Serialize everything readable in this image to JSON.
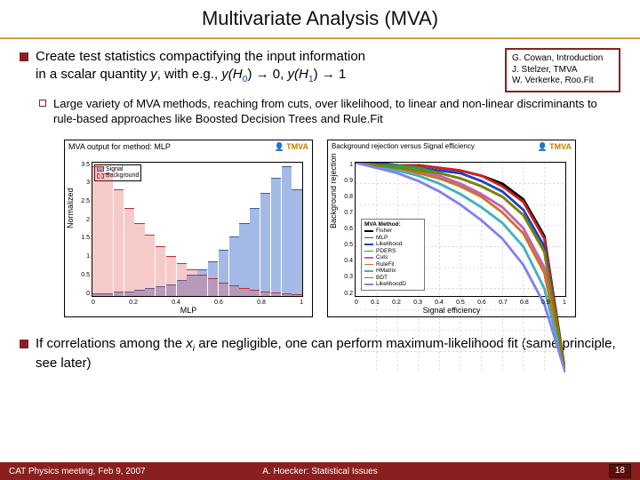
{
  "title": "Multivariate Analysis (MVA)",
  "bullet1": {
    "line1": "Create test statistics compactifying the input information",
    "line2_pre": "in a scalar quantity ",
    "y": "y",
    "mid1": ", with e.g., ",
    "yh0": "y(H",
    "h0sub": "0",
    "arrow1": ") → 0, ",
    "yh1": "y(H",
    "h1sub": "1",
    "arrow2": ") → 1"
  },
  "refs": {
    "l1": "G. Cowan, Introduction",
    "l2": "J. Stelzer, TMVA",
    "l3": "W. Verkerke, Roo.Fit"
  },
  "bullet2": "Large variety of MVA methods, reaching from cuts, over likelihood, to linear and non-linear discriminants to rule-based approaches like Boosted Decision Trees and Rule.Fit",
  "chart1": {
    "title": "MVA output for method: MLP",
    "logo": "TMVA",
    "ylabel": "Normalized",
    "xlabel": "MLP",
    "legend_sig": "Signal",
    "legend_bkg": "Background",
    "xticks": [
      "0",
      "0.2",
      "0.4",
      "0.6",
      "0.8",
      "1"
    ],
    "yticks": [
      "0",
      "0.5",
      "1",
      "1.5",
      "2",
      "2.5",
      "3",
      "3.5"
    ]
  },
  "chart2": {
    "title": "Background rejection versus Signal efficiency",
    "logo": "TMVA",
    "ylabel": "Background rejection",
    "xlabel": "Signal efficiency",
    "legend_head": "MVA Method:",
    "methods": [
      "Fisher",
      "MLP",
      "Likelihood",
      "PDERS",
      "Cuts",
      "RuleFit",
      "HMatrix",
      "BDT",
      "LikelihoodD"
    ],
    "colors": [
      "#000000",
      "#d02020",
      "#2040c0",
      "#20a050",
      "#c060c0",
      "#d07020",
      "#40b0c0",
      "#808000",
      "#8080f0"
    ],
    "xticks": [
      "0",
      "0.1",
      "0.2",
      "0.3",
      "0.4",
      "0.5",
      "0.6",
      "0.7",
      "0.8",
      "0.9",
      "1"
    ],
    "yticks": [
      "0.2",
      "0.3",
      "0.4",
      "0.5",
      "0.6",
      "0.7",
      "0.8",
      "0.9",
      "1"
    ]
  },
  "bullet3": {
    "pre": "If correlations among the ",
    "xi": "x",
    "isub": "i",
    "post": " are negligible, one can perform maximum-likelihood fit (same principle, see later)"
  },
  "footer": {
    "left": "CAT Physics meeting, Feb 9, 2007",
    "center": "A. Hoecker: Statistical Issues",
    "page": "18"
  },
  "chart_data": [
    {
      "type": "bar",
      "title": "MVA output for method: MLP",
      "xlabel": "MLP",
      "ylabel": "Normalized",
      "xlim": [
        0,
        1
      ],
      "ylim": [
        0,
        3.5
      ],
      "x_bin_centers": [
        0.025,
        0.075,
        0.125,
        0.175,
        0.225,
        0.275,
        0.325,
        0.375,
        0.425,
        0.475,
        0.525,
        0.575,
        0.625,
        0.675,
        0.725,
        0.775,
        0.825,
        0.875,
        0.925,
        0.975
      ],
      "series": [
        {
          "name": "Signal",
          "values": [
            0.05,
            0.05,
            0.1,
            0.1,
            0.15,
            0.2,
            0.25,
            0.3,
            0.4,
            0.55,
            0.7,
            0.9,
            1.2,
            1.55,
            1.9,
            2.3,
            2.7,
            3.1,
            3.4,
            2.8
          ]
        },
        {
          "name": "Background",
          "values": [
            3.4,
            3.2,
            2.8,
            2.3,
            1.9,
            1.6,
            1.3,
            1.05,
            0.85,
            0.7,
            0.55,
            0.45,
            0.35,
            0.28,
            0.2,
            0.15,
            0.1,
            0.08,
            0.05,
            0.03
          ]
        }
      ]
    },
    {
      "type": "line",
      "title": "Background rejection versus Signal efficiency",
      "xlabel": "Signal efficiency",
      "ylabel": "Background rejection",
      "xlim": [
        0,
        1
      ],
      "ylim": [
        0.2,
        1
      ],
      "x": [
        0.0,
        0.1,
        0.2,
        0.3,
        0.4,
        0.5,
        0.6,
        0.7,
        0.8,
        0.9,
        1.0
      ],
      "series": [
        {
          "name": "Fisher",
          "values": [
            1.0,
            1.0,
            0.99,
            0.99,
            0.98,
            0.97,
            0.95,
            0.92,
            0.86,
            0.72,
            0.2
          ]
        },
        {
          "name": "MLP",
          "values": [
            1.0,
            1.0,
            0.99,
            0.99,
            0.98,
            0.97,
            0.95,
            0.91,
            0.85,
            0.71,
            0.2
          ]
        },
        {
          "name": "Likelihood",
          "values": [
            1.0,
            1.0,
            0.99,
            0.98,
            0.97,
            0.96,
            0.93,
            0.89,
            0.82,
            0.68,
            0.2
          ]
        },
        {
          "name": "PDERS",
          "values": [
            1.0,
            0.99,
            0.99,
            0.98,
            0.96,
            0.94,
            0.91,
            0.87,
            0.8,
            0.66,
            0.2
          ]
        },
        {
          "name": "Cuts",
          "values": [
            1.0,
            0.99,
            0.98,
            0.97,
            0.95,
            0.92,
            0.88,
            0.83,
            0.75,
            0.6,
            0.2
          ]
        },
        {
          "name": "RuleFit",
          "values": [
            1.0,
            0.99,
            0.98,
            0.96,
            0.94,
            0.91,
            0.87,
            0.81,
            0.73,
            0.58,
            0.2
          ]
        },
        {
          "name": "HMatrix",
          "values": [
            1.0,
            0.99,
            0.97,
            0.95,
            0.92,
            0.88,
            0.83,
            0.77,
            0.68,
            0.52,
            0.2
          ]
        },
        {
          "name": "BDT",
          "values": [
            1.0,
            0.99,
            0.98,
            0.97,
            0.96,
            0.94,
            0.91,
            0.87,
            0.8,
            0.66,
            0.2
          ]
        },
        {
          "name": "LikelihoodD",
          "values": [
            1.0,
            0.98,
            0.96,
            0.93,
            0.89,
            0.84,
            0.78,
            0.71,
            0.61,
            0.46,
            0.2
          ]
        }
      ]
    }
  ]
}
